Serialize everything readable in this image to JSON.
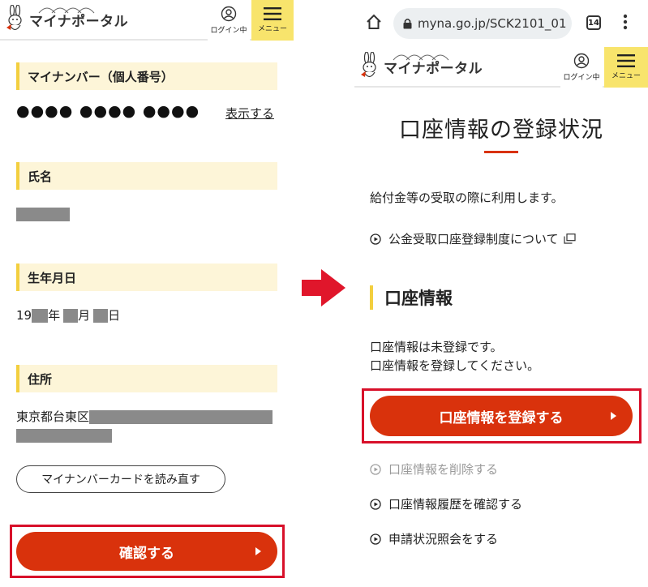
{
  "left_screen": {
    "header": {
      "logo_text": "マイナポータル",
      "login_label": "ログイン中",
      "menu_label": "メニュー"
    },
    "sections": {
      "my_number": {
        "heading": "マイナンバー（個人番号）",
        "masked_value": "●●●● ●●●● ●●●●",
        "show_link": "表示する"
      },
      "name": {
        "heading": "氏名"
      },
      "birthdate": {
        "heading": "生年月日",
        "prefix": "19",
        "year_suffix": "年",
        "month_suffix": "月",
        "day_suffix": "日"
      },
      "address": {
        "heading": "住所",
        "prefix": "東京都台東区"
      }
    },
    "reread_card_button": "マイナンバーカードを読み直す",
    "confirm_button": "確認する"
  },
  "right_screen": {
    "browser": {
      "url": "myna.go.jp/SCK2101_01",
      "tab_count": "14"
    },
    "header": {
      "logo_text": "マイナポータル",
      "login_label": "ログイン中",
      "menu_label": "メニュー"
    },
    "page_title": "口座情報の登録状況",
    "description": "給付金等の受取の際に利用します。",
    "about_link": "公金受取口座登録制度について",
    "account_section": {
      "heading": "口座情報",
      "status_line1": "口座情報は未登録です。",
      "status_line2": "口座情報を登録してください。"
    },
    "register_button": "口座情報を登録する",
    "links": {
      "delete": "口座情報を削除する",
      "history": "口座情報履歴を確認する",
      "inquiry": "申請状況照会をする"
    }
  },
  "colors": {
    "accent_red": "#d9320c",
    "highlight_frame": "#d8102a",
    "heading_bg": "#fdf5d8",
    "heading_bar": "#f3cf3f",
    "menu_bg": "#f8e46c"
  }
}
